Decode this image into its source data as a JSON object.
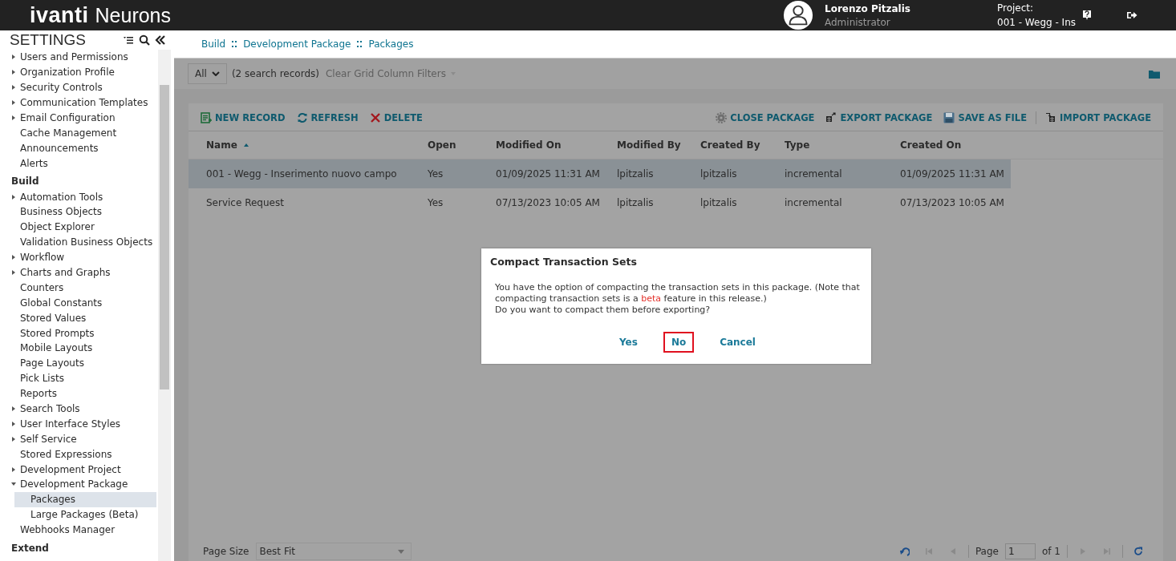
{
  "header": {
    "logo_brand": "ivanti",
    "logo_product": "Neurons",
    "user": {
      "name": "Lorenzo Pitzalis",
      "role": "Administrator"
    },
    "project": {
      "label": "Project:",
      "value": "001 - Wegg - Ins"
    }
  },
  "sidebar": {
    "title": "SETTINGS",
    "sections": [
      {
        "items": [
          {
            "label": "Users and Permissions",
            "expanded": false
          },
          {
            "label": "Organization Profile",
            "expanded": false
          },
          {
            "label": "Security Controls",
            "expanded": false
          },
          {
            "label": "Communication Templates",
            "expanded": false
          },
          {
            "label": "Email Configuration",
            "expanded": false
          },
          {
            "label": "Cache Management"
          },
          {
            "label": "Announcements"
          },
          {
            "label": "Alerts"
          }
        ]
      },
      {
        "heading": "Build",
        "items": [
          {
            "label": "Automation Tools",
            "expanded": false
          },
          {
            "label": "Business Objects"
          },
          {
            "label": "Object Explorer"
          },
          {
            "label": "Validation Business Objects"
          },
          {
            "label": "Workflow",
            "expanded": false
          },
          {
            "label": "Charts and Graphs",
            "expanded": false
          },
          {
            "label": "Counters"
          },
          {
            "label": "Global Constants"
          },
          {
            "label": "Stored Values"
          },
          {
            "label": "Stored Prompts"
          },
          {
            "label": "Mobile Layouts"
          },
          {
            "label": "Page Layouts"
          },
          {
            "label": "Pick Lists"
          },
          {
            "label": "Reports"
          },
          {
            "label": "Search Tools",
            "expanded": false
          },
          {
            "label": "User Interface Styles",
            "expanded": false
          },
          {
            "label": "Self Service",
            "expanded": false
          },
          {
            "label": "Stored Expressions"
          },
          {
            "label": "Development Project",
            "expanded": false
          },
          {
            "label": "Development Package",
            "expanded": true,
            "children": [
              {
                "label": "Packages",
                "selected": true
              },
              {
                "label": "Large Packages (Beta)",
                "selected": false
              }
            ]
          },
          {
            "label": "Webhooks Manager"
          }
        ]
      },
      {
        "heading": "Extend"
      }
    ]
  },
  "breadcrumb": [
    "Build",
    "Development Package",
    "Packages"
  ],
  "filter_bar": {
    "scope": "All",
    "count": "(2 search records)",
    "clear_filters": "Clear Grid Column Filters"
  },
  "toolbar": {
    "left": [
      {
        "kind": "new",
        "label": "NEW RECORD"
      },
      {
        "kind": "refresh",
        "label": "REFRESH"
      },
      {
        "kind": "delete",
        "label": "DELETE"
      }
    ],
    "right": [
      {
        "kind": "close",
        "label": "CLOSE PACKAGE"
      },
      {
        "kind": "export",
        "label": "EXPORT PACKAGE"
      },
      {
        "kind": "save",
        "label": "SAVE AS FILE"
      },
      {
        "kind": "import",
        "label": "IMPORT PACKAGE"
      }
    ]
  },
  "table": {
    "columns": [
      {
        "label": "Name",
        "sorted": true
      },
      {
        "label": "Open",
        "sorted": false
      },
      {
        "label": "Modified On",
        "sorted": false
      },
      {
        "label": "Modified By",
        "sorted": false
      },
      {
        "label": "Created By",
        "sorted": false
      },
      {
        "label": "Type",
        "sorted": false
      },
      {
        "label": "Created On",
        "sorted": false
      }
    ],
    "rows": [
      {
        "selected": true,
        "cells": [
          "001 - Wegg - Inserimento nuovo campo",
          "Yes",
          "01/09/2025 11:31 AM",
          "lpitzalis",
          "lpitzalis",
          "incremental",
          "01/09/2025 11:31 AM"
        ]
      },
      {
        "selected": false,
        "cells": [
          "Service Request",
          "Yes",
          "07/13/2023 10:05 AM",
          "lpitzalis",
          "lpitzalis",
          "incremental",
          "07/13/2023 10:05 AM"
        ]
      }
    ]
  },
  "pager": {
    "page_size_label": "Page Size",
    "page_size": "Best Fit",
    "page_label": "Page",
    "page": "1",
    "of": "of 1"
  },
  "dialog": {
    "title": "Compact Transaction Sets",
    "beta_word": "beta",
    "message_before": "You have the option of compacting the transaction sets in this package. (Note that compacting transaction sets is a ",
    "message_after": " feature in this release.)",
    "question": "Do you want to compact them before exporting?",
    "buttons": [
      {
        "label": "Yes",
        "focused": false
      },
      {
        "label": "No",
        "focused": true
      },
      {
        "label": "Cancel",
        "focused": false
      }
    ]
  }
}
